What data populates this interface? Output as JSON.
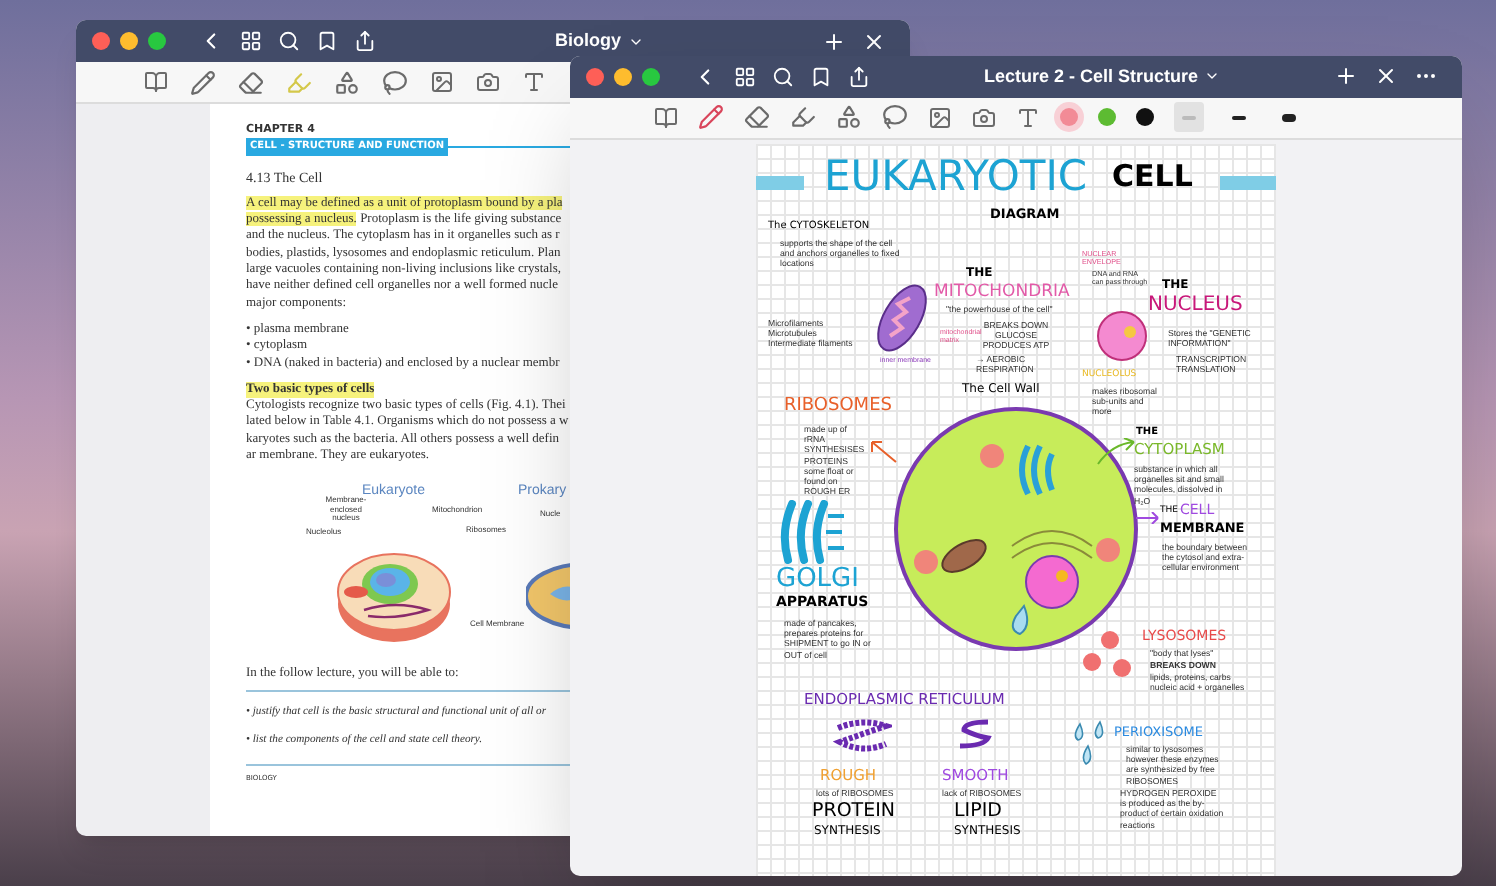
{
  "book_window": {
    "title": "Biology",
    "page": {
      "chapter": "CHAPTER 4",
      "chapter_title": "CELL - STRUCTURE AND FUNCTION",
      "section": "4.13 The Cell",
      "paragraph_1": [
        [
          {
            "text": "A cell may be defined as a unit of protoplasm bound by a pla",
            "highlighted": true
          }
        ],
        [
          {
            "text": "possessing a nucleus.",
            "highlighted": true
          },
          {
            "text": " Protoplasm is the life giving substance",
            "highlighted": false
          }
        ],
        [
          {
            "text": "and the nucleus. The cytoplasm has in it organelles such as r",
            "highlighted": false
          }
        ],
        [
          {
            "text": "bodies, plastids, lysosomes and endoplasmic reticulum. Plan",
            "highlighted": false
          }
        ],
        [
          {
            "text": "large vacuoles containing non-living inclusions like crystals,",
            "highlighted": false
          }
        ],
        [
          {
            "text": "have neither defined cell organelles nor a well formed nucle",
            "highlighted": false
          }
        ],
        [
          {
            "text": "major components:",
            "highlighted": false
          }
        ]
      ],
      "components": [
        "• plasma membrane",
        "• cytoplasm",
        "• DNA (naked in bacteria) and enclosed by a nuclear membr"
      ],
      "subheading": {
        "text": "Two basic types of cells",
        "highlighted": true
      },
      "paragraph_2": [
        "Cytologists recognize two basic types of cells (Fig. 4.1). Thei",
        "lated below in Table 4.1. Organisms which do not possess a w",
        "karyotes such as the bacteria. All others possess a well defin",
        "ar membrane. They are eukaryotes."
      ],
      "figure": {
        "eukaryote_title": "Eukaryote",
        "prokaryote_title": "Prokary",
        "membrane_nucleus": "Membrane-enclosed nucleus",
        "mitochondrion": "Mitochondrion",
        "nucleolus": "Nucleolus",
        "ribosomes": "Ribosomes",
        "cell_membrane": "Cell Membrane",
        "prokaryote_label": "Nucle"
      },
      "lead_in": "In the follow lecture, you will be able to:",
      "objectives": [
        "• justify that cell is the basic structural and functional unit of all or",
        "• list the components of the cell and state cell theory."
      ],
      "footer": "BIOLOGY"
    }
  },
  "notes_window": {
    "title": "Lecture 2 - Cell Structure",
    "colors": [
      {
        "color": "#f28b96",
        "selected": true
      },
      {
        "color": "#5dbb32",
        "selected": false
      },
      {
        "color": "#111111",
        "selected": false
      }
    ],
    "stroke_widths": [
      {
        "selected": true
      },
      {
        "selected": false
      },
      {
        "selected": false
      }
    ],
    "note": {
      "title": "EUKARYOTIC",
      "title_2": "CELL",
      "subtitle": "DIAGRAM",
      "cytoskeleton": {
        "heading": "The CYTOSKELETON",
        "description": "supports the shape of the cell and anchors organelles to fixed locations",
        "types": [
          "Microfilaments",
          "Microtubules",
          "Intermediate filaments"
        ]
      },
      "mitochondria": {
        "prefix": "THE",
        "heading": "MITOCHONDRIA",
        "quote": "\"the powerhouse of the cell\"",
        "function": "BREAKS DOWN GLUCOSE PRODUCES ATP",
        "process": "→ AEROBIC RESPIRATION",
        "labels": [
          "mitochondrial matrix",
          "inner membrane"
        ]
      },
      "nucleus": {
        "envelope_label": "NUCLEAR ENVELOPE",
        "envelope_note": "DNA and RNA can pass through",
        "prefix": "THE",
        "heading": "NUCLEUS",
        "description": "Stores the \"GENETIC INFORMATION\"",
        "processes": [
          "TRANSCRIPTION",
          "TRANSLATION"
        ],
        "nucleolus_label": "NUCLEOLUS",
        "nucleolus_note": "makes ribosomal sub-units and more"
      },
      "cell_wall_label": "The Cell Wall",
      "ribosomes": {
        "heading": "RIBOSOMES",
        "notes": [
          "made up of rRNA",
          "SYNTHESISES PROTEINS",
          "some float or found on ROUGH ER"
        ]
      },
      "cytoplasm": {
        "prefix": "THE",
        "heading": "CYTOPLASM",
        "description": "substance in which all organelles sit and small molecules, dissolved in H₂O"
      },
      "cell_membrane": {
        "prefix": "THE",
        "heading": "CELL",
        "heading_2": "MEMBRANE",
        "description": "the boundary between the cytosol and extra-cellular environment"
      },
      "golgi": {
        "heading": "GOLGI",
        "heading_2": "APPARATUS",
        "description": "made of pancakes, prepares proteins for SHIPMENT to go IN or OUT of cell"
      },
      "lysosomes": {
        "heading": "LYSOSOMES",
        "quote": "\"body that lyses\"",
        "function": "BREAKS DOWN",
        "targets": "lipids, proteins, carbs nucleic acid + organelles"
      },
      "er": {
        "heading": "ENDOPLASMIC RETICULUM",
        "rough": {
          "heading": "ROUGH",
          "note": "lots of RIBOSOMES",
          "role": "PROTEIN",
          "role_2": "SYNTHESIS"
        },
        "smooth": {
          "heading": "SMOOTH",
          "note": "lack of RIBOSOMES",
          "role": "LIPID",
          "role_2": "SYNTHESIS"
        }
      },
      "perioxisome": {
        "heading": "PERIOXISOME",
        "notes": [
          "similar to lysosomes",
          "however these enzymes are synthesized by free RIBOSOMES"
        ],
        "byproduct": "HYDROGEN PEROXIDE is produced as the by-product of certain oxidation reactions"
      }
    }
  }
}
